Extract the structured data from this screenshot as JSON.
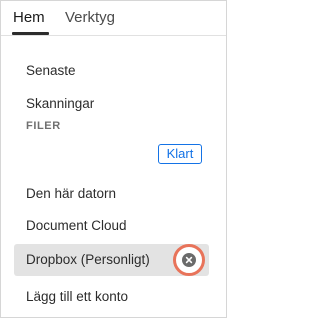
{
  "tabs": [
    {
      "label": "Hem",
      "active": true
    },
    {
      "label": "Verktyg",
      "active": false
    }
  ],
  "nav": {
    "recent": "Senaste",
    "scans": "Skanningar"
  },
  "files_section": {
    "label": "FILER",
    "done_button": "Klart",
    "items": [
      {
        "label": "Den här datorn"
      },
      {
        "label": "Document Cloud"
      },
      {
        "label": "Dropbox (Personligt)",
        "selected": true
      },
      {
        "label": "Lägg till ett konto"
      }
    ]
  },
  "icons": {
    "remove": "close-circle-icon"
  },
  "colors": {
    "accent": "#1473e6",
    "highlight_ring": "#e8735a",
    "selected_row": "#e3e3e3"
  }
}
